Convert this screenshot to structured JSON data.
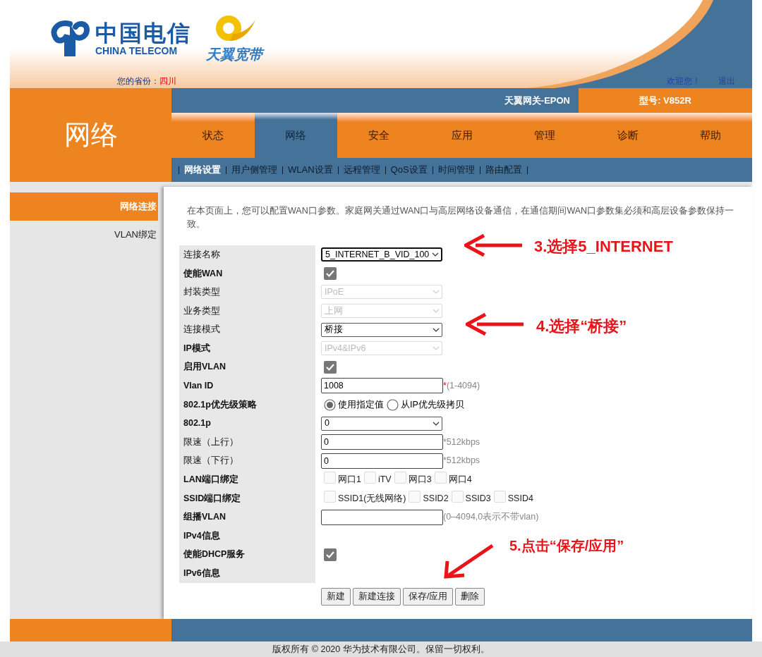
{
  "header": {
    "logo_cn": "中国电信",
    "logo_en": "CHINA TELECOM",
    "brand": "天翼宽带",
    "province_label": "您的省份：",
    "province": "四川",
    "welcome": "欢迎您！",
    "logout": "退出"
  },
  "gateway_title": "天翼网关-EPON",
  "model": "型号: V852R",
  "section_title": "网络",
  "tabs": [
    {
      "label": "状态",
      "selected": false
    },
    {
      "label": "网络",
      "selected": true
    },
    {
      "label": "安全",
      "selected": false
    },
    {
      "label": "应用",
      "selected": false
    },
    {
      "label": "管理",
      "selected": false
    },
    {
      "label": "诊断",
      "selected": false
    },
    {
      "label": "帮助",
      "selected": false
    }
  ],
  "subnav": [
    {
      "label": "网络设置",
      "selected": true
    },
    {
      "label": "用户侧管理",
      "selected": false
    },
    {
      "label": "WLAN设置",
      "selected": false
    },
    {
      "label": "远程管理",
      "selected": false
    },
    {
      "label": "QoS设置",
      "selected": false
    },
    {
      "label": "时间管理",
      "selected": false
    },
    {
      "label": "路由配置",
      "selected": false
    }
  ],
  "sidebar": [
    {
      "label": "网络连接",
      "selected": true
    },
    {
      "label": "VLAN绑定",
      "selected": false
    }
  ],
  "intro": "在本页面上，您可以配置WAN口参数。家庭网关通过WAN口与高层网络设备通信，在通信期间WAN口参数集必须和高层设备参数保持一致。",
  "form": [
    {
      "label": "连接名称",
      "bold": false,
      "kind": "select",
      "value": "5_INTERNET_B_VID_100",
      "disabled": false,
      "focused": true
    },
    {
      "label": "使能WAN",
      "bold": true,
      "kind": "checkbox",
      "checked": true
    },
    {
      "label": "封装类型",
      "bold": false,
      "kind": "select",
      "value": "IPoE",
      "disabled": true
    },
    {
      "label": "业务类型",
      "bold": false,
      "kind": "select",
      "value": "上网",
      "disabled": true
    },
    {
      "label": "连接模式",
      "bold": false,
      "kind": "select",
      "value": "桥接",
      "disabled": false,
      "focused": false
    },
    {
      "label": "IP模式",
      "bold": true,
      "kind": "select",
      "value": "IPv4&IPv6",
      "disabled": true
    },
    {
      "label": "启用VLAN",
      "bold": true,
      "kind": "checkbox",
      "checked": true
    },
    {
      "label": "Vlan ID",
      "bold": true,
      "kind": "text",
      "value": "1008",
      "required_mark": "*",
      "suffix": "(1-4094)"
    },
    {
      "label": "802.1p优先级策略",
      "bold": true,
      "kind": "radio",
      "options": [
        {
          "label": "使用指定值",
          "selected": true
        },
        {
          "label": "从IP优先级拷贝",
          "selected": false
        }
      ]
    },
    {
      "label": "802.1p",
      "bold": true,
      "kind": "select",
      "value": "0",
      "disabled": false,
      "focused": false
    },
    {
      "label": "限速（上行）",
      "bold": false,
      "kind": "text",
      "value": "0",
      "suffix": "*512kbps"
    },
    {
      "label": "限速（下行）",
      "bold": false,
      "kind": "text",
      "value": "0",
      "suffix": "*512kbps"
    },
    {
      "label": "LAN端口绑定",
      "bold": true,
      "kind": "checks",
      "options": [
        {
          "label": "网口1",
          "checked": false
        },
        {
          "label": "iTV",
          "checked": false
        },
        {
          "label": "网口3",
          "checked": false
        },
        {
          "label": "网口4",
          "checked": false
        }
      ]
    },
    {
      "label": "SSID端口绑定",
      "bold": true,
      "kind": "checks",
      "options": [
        {
          "label": "SSID1(无线网络)",
          "checked": false
        },
        {
          "label": "SSID2",
          "checked": false
        },
        {
          "label": "SSID3",
          "checked": false
        },
        {
          "label": "SSID4",
          "checked": false
        }
      ]
    },
    {
      "label": "组播VLAN",
      "bold": true,
      "kind": "text",
      "suffix": "(0–4094,0表示不带vlan)"
    },
    {
      "label": "IPv4信息",
      "bold": true,
      "kind": "none"
    },
    {
      "label": "使能DHCP服务",
      "bold": true,
      "kind": "checkbox",
      "checked": true
    },
    {
      "label": "IPv6信息",
      "bold": true,
      "kind": "none"
    }
  ],
  "buttons": [
    "新建",
    "新建连接",
    "保存/应用",
    "删除"
  ],
  "annotations": [
    "3.选择5_INTERNET",
    "4.选择“桥接”",
    "5.点击“保存/应用”"
  ],
  "copyright": "版权所有 © 2020 华为技术有限公司。保留一切权利。"
}
